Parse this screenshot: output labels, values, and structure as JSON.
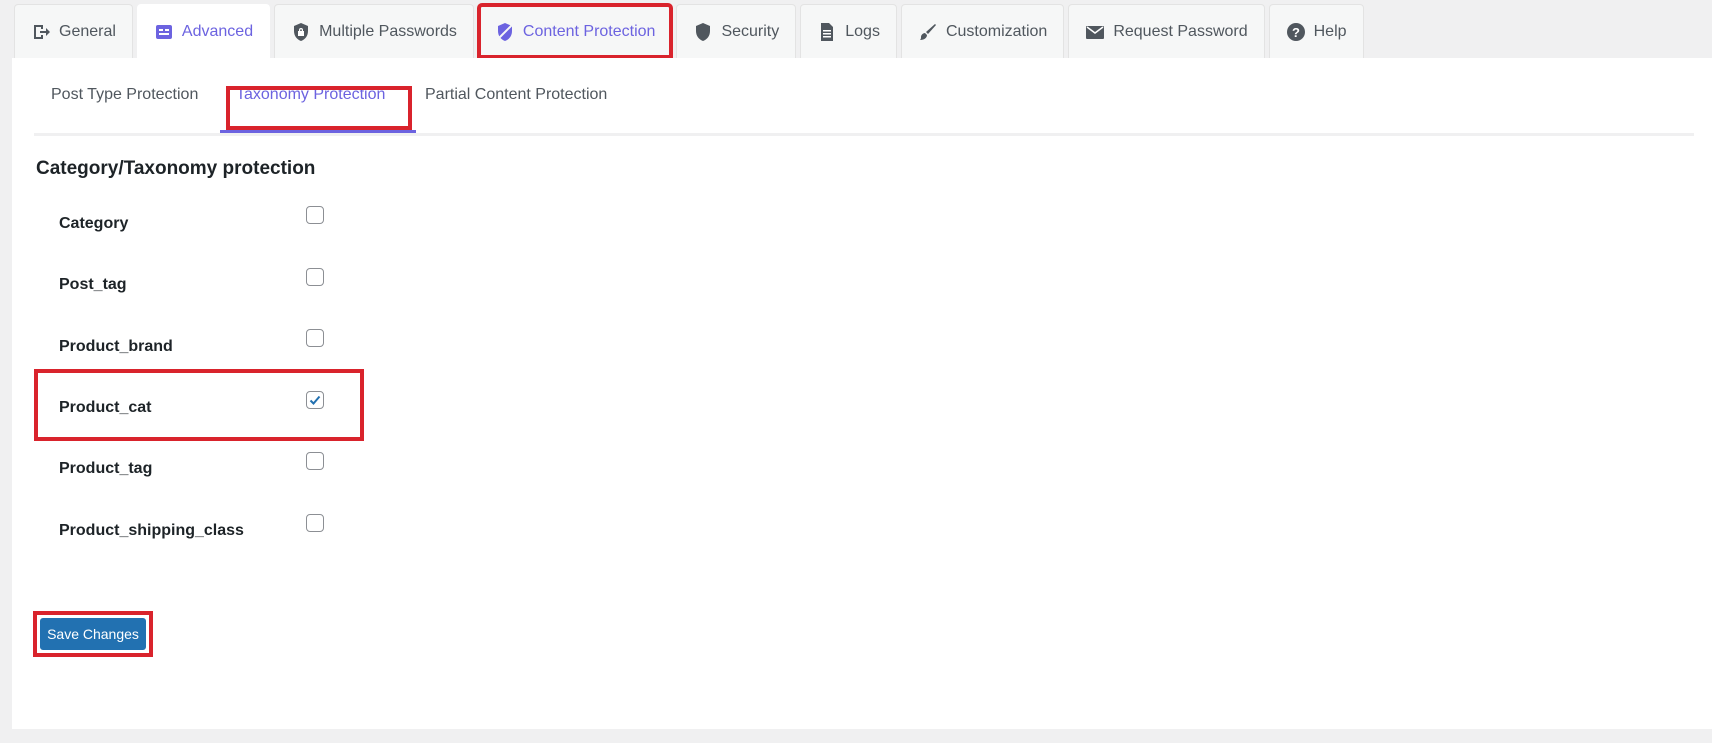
{
  "top_tabs": [
    {
      "label": "General",
      "icon": "general-icon"
    },
    {
      "label": "Advanced",
      "icon": "advanced-icon"
    },
    {
      "label": "Multiple Passwords",
      "icon": "shield-icon"
    },
    {
      "label": "Content Protection",
      "icon": "content-protection-icon"
    },
    {
      "label": "Security",
      "icon": "security-shield-icon"
    },
    {
      "label": "Logs",
      "icon": "document-icon"
    },
    {
      "label": "Customization",
      "icon": "brush-icon"
    },
    {
      "label": "Request Password",
      "icon": "envelope-icon"
    },
    {
      "label": "Help",
      "icon": "help-icon"
    }
  ],
  "sub_tabs": [
    {
      "label": "Post Type Protection"
    },
    {
      "label": "Taxonomy Protection"
    },
    {
      "label": "Partial Content Protection"
    }
  ],
  "section": {
    "title": "Category/Taxonomy protection"
  },
  "taxonomies": [
    {
      "label": "Category",
      "checked": false
    },
    {
      "label": "Post_tag",
      "checked": false
    },
    {
      "label": "Product_brand",
      "checked": false
    },
    {
      "label": "Product_cat",
      "checked": true
    },
    {
      "label": "Product_tag",
      "checked": false
    },
    {
      "label": "Product_shipping_class",
      "checked": false
    }
  ],
  "save_label": "Save Changes",
  "colors": {
    "accent": "#6c63e0",
    "highlight": "#d9232c",
    "button": "#2271b1",
    "checkmark": "#2271b1"
  }
}
